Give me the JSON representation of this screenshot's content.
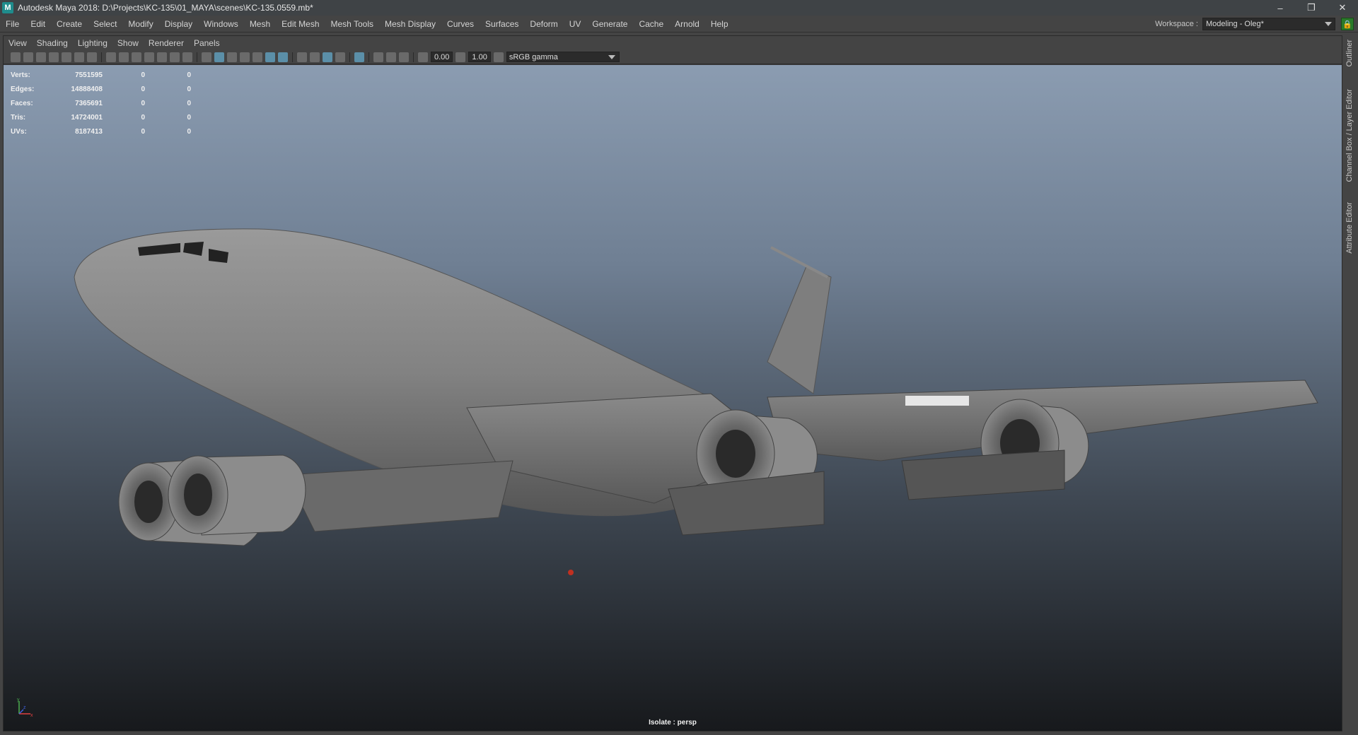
{
  "window": {
    "title": "Autodesk Maya 2018: D:\\Projects\\KC-135\\01_MAYA\\scenes\\KC-135.0559.mb*",
    "app_icon": "M",
    "controls": {
      "minimize": "–",
      "restore": "❐",
      "close": "✕"
    }
  },
  "menubar": {
    "items": [
      "File",
      "Edit",
      "Create",
      "Select",
      "Modify",
      "Display",
      "Windows",
      "Mesh",
      "Edit Mesh",
      "Mesh Tools",
      "Mesh Display",
      "Curves",
      "Surfaces",
      "Deform",
      "UV",
      "Generate",
      "Cache",
      "Arnold",
      "Help"
    ],
    "workspace_label": "Workspace :",
    "workspace_value": "Modeling - Oleg*"
  },
  "panel_menu": {
    "items": [
      "View",
      "Shading",
      "Lighting",
      "Show",
      "Renderer",
      "Panels"
    ]
  },
  "toolbar": {
    "exposure": "0.00",
    "gamma": "1.00",
    "color_space": "sRGB gamma"
  },
  "hud": {
    "rows": [
      {
        "label": "Verts:",
        "total": "7551595",
        "selected": "0",
        "highlighted": "0"
      },
      {
        "label": "Edges:",
        "total": "14888408",
        "selected": "0",
        "highlighted": "0"
      },
      {
        "label": "Faces:",
        "total": "7365691",
        "selected": "0",
        "highlighted": "0"
      },
      {
        "label": "Tris:",
        "total": "14724001",
        "selected": "0",
        "highlighted": "0"
      },
      {
        "label": "UVs:",
        "total": "8187413",
        "selected": "0",
        "highlighted": "0"
      }
    ]
  },
  "viewport": {
    "isolate_label": "Isolate : persp",
    "axis": {
      "y": "y",
      "x": "x",
      "z": "z"
    }
  },
  "side_tabs": [
    "Outliner",
    "Channel Box / Layer Editor",
    "Attribute Editor"
  ]
}
